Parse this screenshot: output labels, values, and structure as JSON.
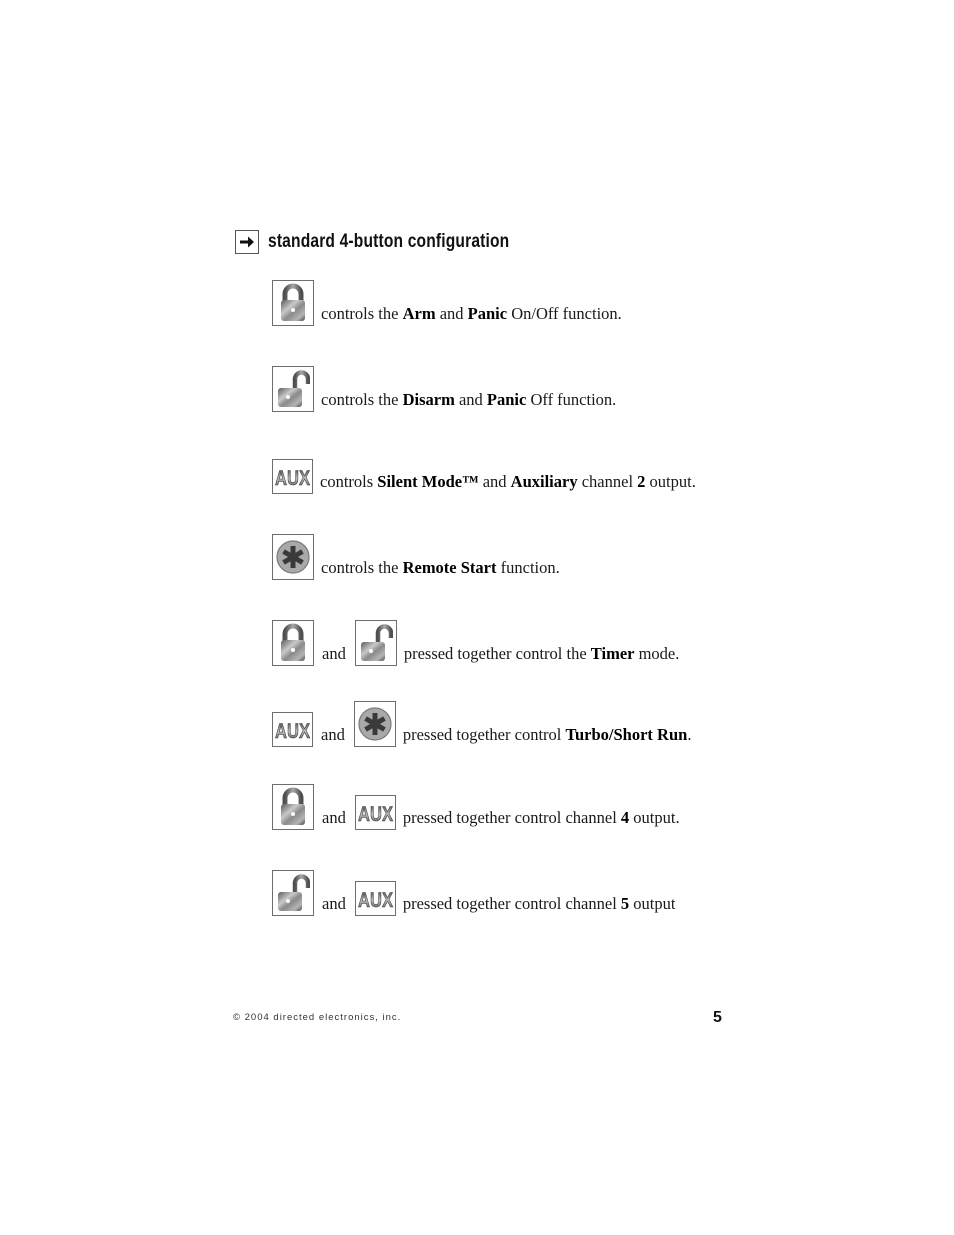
{
  "section": {
    "arrow_icon": "right-arrow-icon",
    "title": "standard 4-button configuration"
  },
  "buttons": {
    "lock": {
      "icon": "lock-closed-icon",
      "label": "Arm / Panic"
    },
    "unlock": {
      "icon": "lock-open-icon",
      "label": "Disarm"
    },
    "aux": {
      "icon": "aux-icon",
      "text": "AUX"
    },
    "star": {
      "icon": "asterisk-icon",
      "label": "Remote Start"
    }
  },
  "rows": [
    {
      "buttons": [
        "lock"
      ],
      "parts": [
        "controls the ",
        "Arm",
        " and ",
        "Panic",
        " On/Off function."
      ]
    },
    {
      "buttons": [
        "unlock"
      ],
      "parts": [
        "controls the ",
        "Disarm",
        " and ",
        "Panic",
        " Off function."
      ]
    },
    {
      "buttons": [
        "aux"
      ],
      "parts": [
        "controls ",
        "Silent Mode™",
        " and ",
        "Auxiliary",
        " channel ",
        "2",
        " output."
      ]
    },
    {
      "buttons": [
        "star"
      ],
      "parts": [
        "controls the ",
        "Remote Start",
        " function."
      ]
    },
    {
      "buttons": [
        "lock",
        "unlock"
      ],
      "joiner": "and",
      "parts": [
        "pressed together control the ",
        "Timer",
        " mode."
      ]
    },
    {
      "buttons": [
        "aux",
        "star"
      ],
      "joiner": "and",
      "parts": [
        "pressed together control ",
        "Turbo/Short Run",
        "."
      ]
    },
    {
      "buttons": [
        "lock",
        "aux"
      ],
      "joiner": "and",
      "parts": [
        "pressed together control channel ",
        "4",
        " output."
      ]
    },
    {
      "buttons": [
        "unlock",
        "aux"
      ],
      "joiner": "and",
      "parts": [
        "pressed together control channel ",
        "5",
        " output"
      ]
    }
  ],
  "footer": {
    "copyright": "© 2004 directed electronics, inc.",
    "page_number": "5"
  }
}
